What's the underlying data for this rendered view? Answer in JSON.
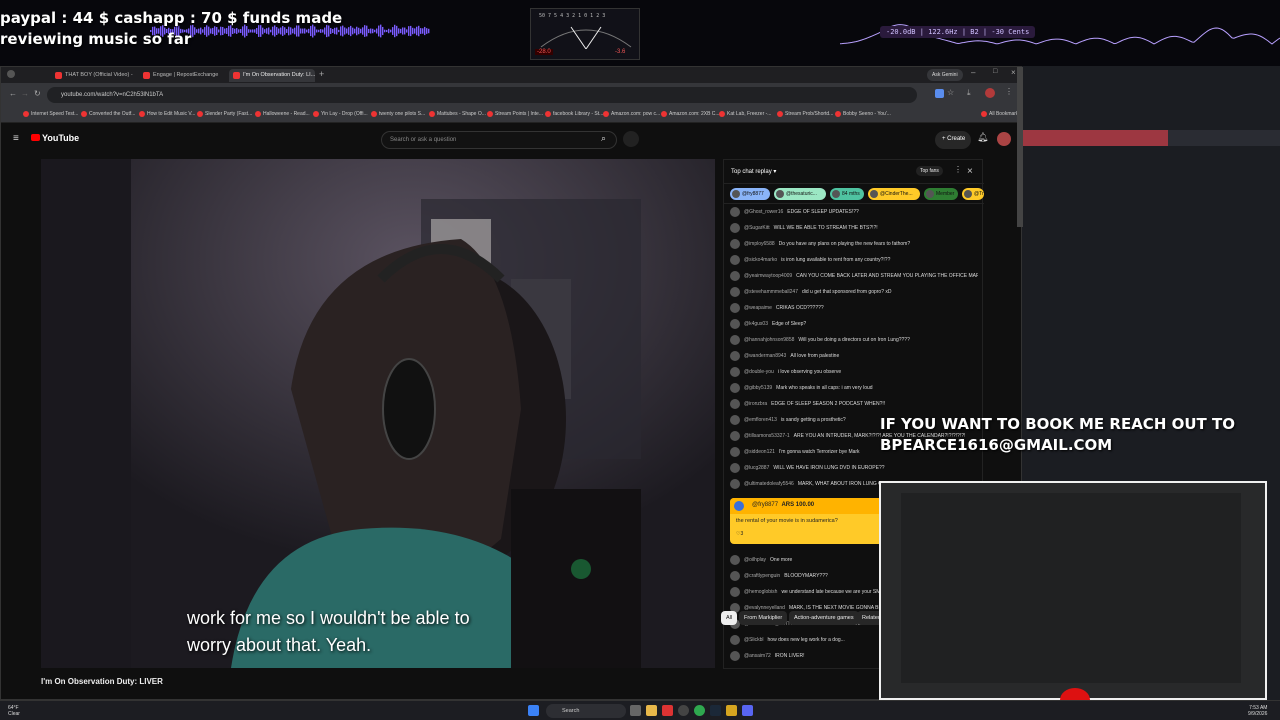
{
  "overlay": {
    "line1": "paypal : 44 $  cashapp : 70 $ funds made",
    "line2": "reviewing music so far",
    "meter_scale": "50 7 5 4 3 2 1 0  1  2  3",
    "meter_left": "-28.0",
    "meter_right": "-3.6",
    "spectrum_readout": "-20.0dB | 122.6Hz | B2 | -30 Cents",
    "book_line1": "IF YOU WANT TO BOOK ME REACH OUT TO",
    "book_line2": "BPEARCE1616@GMAIL.COM"
  },
  "browser": {
    "tabs": [
      {
        "label": "THAT BOY (Official Video) - Yo..."
      },
      {
        "label": "Engage | RepostExchange"
      },
      {
        "label": "I'm On Observation Duty: LI..."
      }
    ],
    "ask_gemini": "Ask Gemini",
    "url": "youtube.com/watch?v=nC2h53lN1bTA",
    "bookmarks": [
      "Internet Speed Test...",
      "Converted the Outf...",
      "How to Edit Music V...",
      "Slender Party (Fast...",
      "Halloweene - Read...",
      "Yin Lay - Drop (Offi...",
      "twenty one pilots S...",
      "Mattubes - Shape O...",
      "Stream Points | Inte...",
      "facebook Library - St...",
      "Amazon.com: pow c...",
      "Amazon.com: 2XB C...",
      "Kat Lab, Freezer -...",
      "Stream Prob/Shortd...",
      "Bobby Seeno - You'...",
      "All Bookmarks"
    ]
  },
  "youtube": {
    "logo": "YouTube",
    "search_placeholder": "Search or ask a question",
    "create": "Create",
    "subtitle_line1": "work for me so I wouldn't be able to",
    "subtitle_line2": "worry about that. Yeah.",
    "video_title": "I'm On Observation Duty: LIVER",
    "chips": [
      "All",
      "From Markiplier",
      "Action-adventure games",
      "Related"
    ]
  },
  "chat": {
    "title": "Top chat replay",
    "top_fans": "Top fans",
    "tickers": [
      {
        "name": "@fry8877",
        "color": "#8ab4f8"
      },
      {
        "name": "@thesaturic...",
        "color": "#9be7c4"
      },
      {
        "name": "84 mths",
        "color": "#4fc3a1"
      },
      {
        "name": "@CinderThe...",
        "color": "#ffca28"
      },
      {
        "name": "Member",
        "color": "#2e7d32"
      },
      {
        "name": "@Tr",
        "color": "#ffca28"
      }
    ],
    "messages": [
      {
        "author": "@Ghost_rower16",
        "text": "EDGE OF SLEEP UPDATES!??"
      },
      {
        "author": "@SugarKitt",
        "text": "WILL WE BE ABLE TO STREAM THE BTS?!?!"
      },
      {
        "author": "@imploy6588",
        "text": "Do you have any plans on playing the new fears to fathom?"
      },
      {
        "author": "@sicko4marko",
        "text": "is iron lung available to rent from any country?!??"
      },
      {
        "author": "@yeaimwaytoop4009",
        "text": "CAN YOU COME BACK LATER AND STREAM YOU PLAYING THE OFFICE MAP"
      },
      {
        "author": "@stevehammmeball247",
        "text": "did u get that sponsored from gopro? xD"
      },
      {
        "author": "@weapaime",
        "text": "CRIKAS OCD??????"
      },
      {
        "author": "@k4gus03",
        "text": "Edge of Sleep?"
      },
      {
        "author": "@hannahjohnson9858",
        "text": "Will you be doing a directors cut on Iron Lung????"
      },
      {
        "author": "@wanderman8943",
        "text": "All love from palestine"
      },
      {
        "author": "@double-you",
        "text": "i love observing you observe"
      },
      {
        "author": "@gibby5139",
        "text": "Mark who speaks in all caps: i am very loud"
      },
      {
        "author": "@ironzbra",
        "text": "EDGE OF SLEEP SEASON 2 PODCAST WHEN?!!"
      },
      {
        "author": "@emfloren413",
        "text": "is sandy getting a prosthetic?"
      },
      {
        "author": "@tillsamons53327-1",
        "text": "ARE YOU AN INTRUDER, MARK?!?!?! ARE YOU THE CALENDAR?!?!?!?!?!"
      },
      {
        "author": "@siddeon121",
        "text": "I'm gonna watch Terrorizer bye Mark"
      },
      {
        "author": "@lucg2887",
        "text": "WILL WE HAVE IRON LUNG DVD IN EUROPE??"
      },
      {
        "author": "@ultimatedoleafy5546",
        "text": "MARK, WHAT ABOUT IRON LUNG ON STREAMING? I WOULD BE ABLE TO SEE IT IN THE FUTURE MR IPLIER"
      },
      {
        "author": "@oilhplay",
        "text": "One more"
      },
      {
        "author": "@craftlypenguin",
        "text": "BLOODYMARY???"
      },
      {
        "author": "@hemoglobish",
        "text": "we understand late because we are your SMARTEST"
      },
      {
        "author": "@evalynneyelland",
        "text": "MARK, IS THE NEXT MOVIE GONNA BE CALLED WITH THE TITLE??"
      },
      {
        "author": "@UNKNOWN_SHTITY3",
        "text": "EDGE OF SLEEP SEASON 2 MARK?!!"
      },
      {
        "author": "@Slickbl",
        "text": "how does new leg work for a dog..."
      },
      {
        "author": "@ansaim72",
        "text": "IRON LIVER!"
      }
    ],
    "superchat": {
      "author": "@fry8877",
      "amount": "ARS 100.00",
      "text": "the rental of your movie is in sudamerica?",
      "likes": "3"
    }
  },
  "taskbar": {
    "weather_temp": "64°F",
    "weather_desc": "Clear",
    "search": "Search",
    "time": "7:53 AM",
    "date": "9/9/2026"
  },
  "colors": {
    "accent_red": "#ff0000",
    "superchat": "#ffca28",
    "overlay_wave": "#7b5cff"
  }
}
